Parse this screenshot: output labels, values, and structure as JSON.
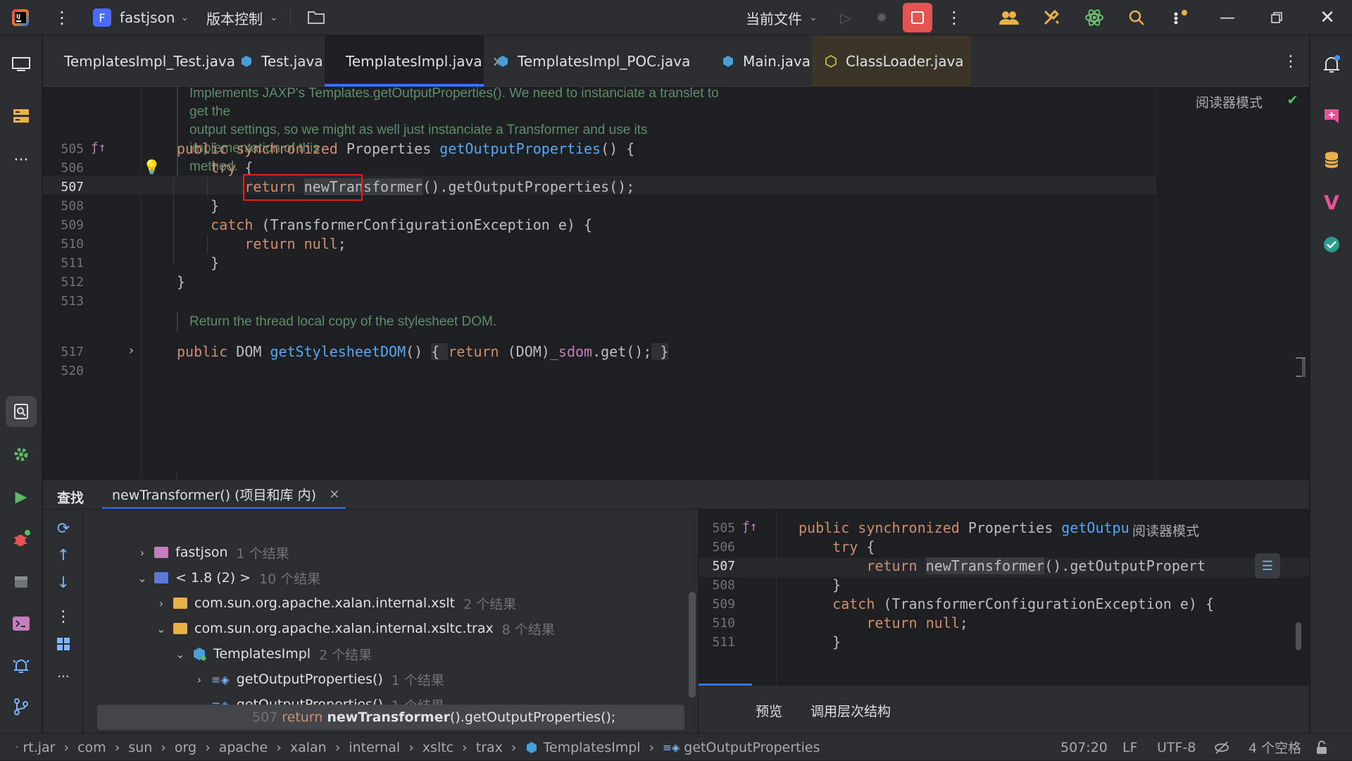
{
  "titlebar": {
    "project_initial": "F",
    "project_name": "fastjson",
    "vcs_label": "版本控制",
    "run_config": "当前文件"
  },
  "tabs": [
    {
      "label": "TemplatesImpl_Test.java"
    },
    {
      "label": "Test.java"
    },
    {
      "label": "TemplatesImpl.java"
    },
    {
      "label": "TemplatesImpl_POC.java"
    },
    {
      "label": "Main.java"
    },
    {
      "label": "ClassLoader.java"
    }
  ],
  "tab_close": "×",
  "editor": {
    "reader_mode": "阅读器模式",
    "doc1": [
      "Implements JAXP's Templates.getOutputProperties(). We need to instanciate a translet to get the",
      "output settings, so we might as well just instanciate a Transformer and use its implementation of this",
      "method."
    ],
    "doc2": "Return the thread local copy of the stylesheet DOM.",
    "line_numbers": [
      "505",
      "506",
      "507",
      "508",
      "509",
      "510",
      "511",
      "512",
      "513",
      "517",
      "520"
    ]
  },
  "find": {
    "title": "查找",
    "query_tab": "newTransformer() (项目和库 内)",
    "close": "×",
    "tree": [
      {
        "label": "fastjson",
        "count": "1 个结果"
      },
      {
        "label": "< 1.8 (2) >",
        "count": "10 个结果"
      },
      {
        "label": "com.sun.org.apache.xalan.internal.xslt",
        "count": "2 个结果"
      },
      {
        "label": "com.sun.org.apache.xalan.internal.xsltc.trax",
        "count": "8 个结果"
      },
      {
        "label": "TemplatesImpl",
        "count": "2 个结果"
      },
      {
        "label": "getOutputProperties()",
        "count": "1 个结果"
      },
      {
        "label": "getOutputProperties()",
        "count": "1 个结果"
      }
    ],
    "result_line": "507",
    "result_kw": "return",
    "result_call": "newTransformer",
    "result_rest": "().getOutputProperties();",
    "preview_tab": "预览",
    "hierarchy_tab": "调用层次结构",
    "preview_reader_mode": "阅读器模式",
    "preview_line_numbers": [
      "505",
      "506",
      "507",
      "508",
      "509",
      "510",
      "511"
    ]
  },
  "breadcrumb": [
    "rt.jar",
    "com",
    "sun",
    "org",
    "apache",
    "xalan",
    "internal",
    "xsltc",
    "trax",
    "TemplatesImpl",
    "getOutputProperties"
  ],
  "status": {
    "position": "507:20",
    "line_sep": "LF",
    "encoding": "UTF-8",
    "indent": "4 个空格"
  }
}
